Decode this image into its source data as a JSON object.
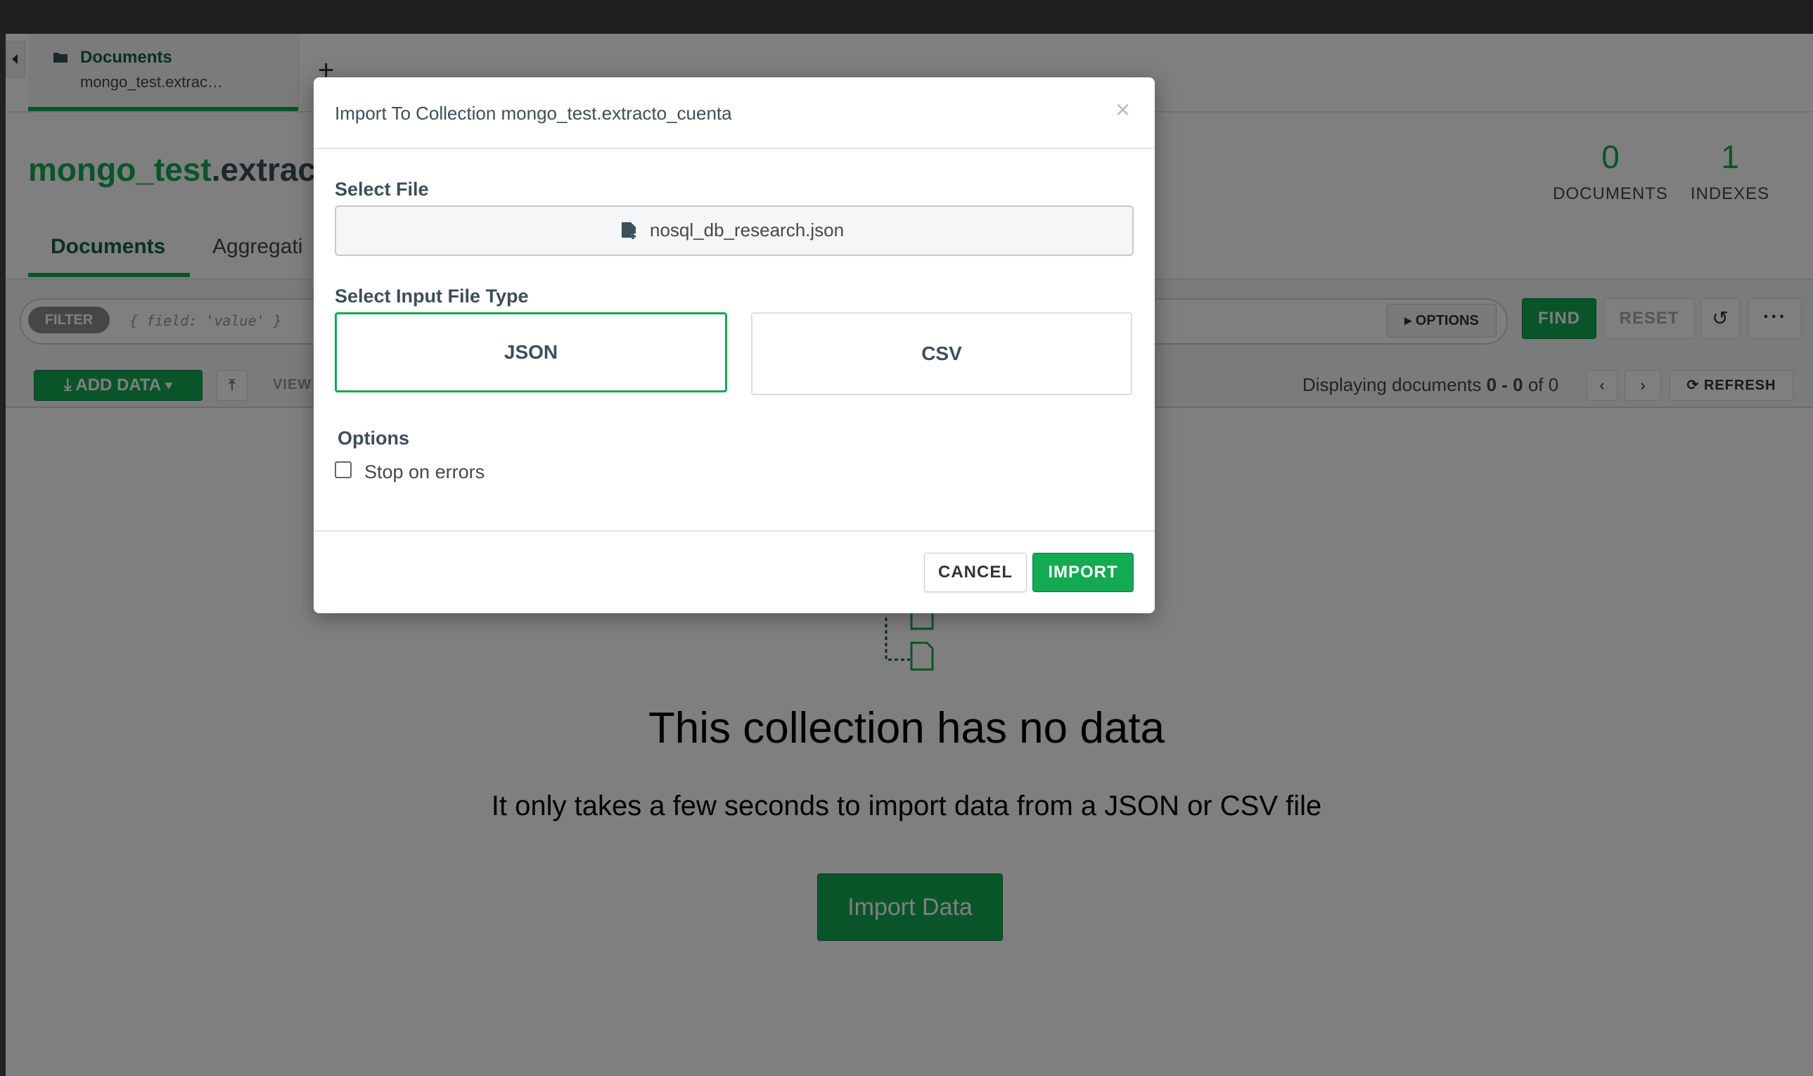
{
  "tab": {
    "title": "Documents",
    "subtitle": "mongo_test.extrac…",
    "add_label": "+"
  },
  "collection": {
    "db": "mongo_test",
    "name": ".extract"
  },
  "stats": {
    "documents_count": "0",
    "documents_label": "DOCUMENTS",
    "indexes_count": "1",
    "indexes_label": "INDEXES"
  },
  "subtabs": [
    {
      "label": "Documents",
      "active": true
    },
    {
      "label": "Aggregati"
    }
  ],
  "filter": {
    "pill_label": "FILTER",
    "placeholder": "{ field: 'value' }",
    "options_label": "OPTIONS",
    "find_label": "FIND",
    "reset_label": "RESET"
  },
  "toolbar": {
    "add_data_label": "ADD DATA",
    "view_label": "VIEW",
    "displaying_prefix": "Displaying documents ",
    "displaying_range": "0 - 0",
    "displaying_of": " of ",
    "displaying_total": "0",
    "refresh_label": "REFRESH"
  },
  "empty_state": {
    "title": "This collection has no data",
    "subtitle": "It only takes a few seconds to import data from a JSON or CSV file",
    "button_label": "Import Data"
  },
  "modal": {
    "title": "Import To Collection mongo_test.extracto_cuenta",
    "close_glyph": "×",
    "select_file_label": "Select File",
    "file_name": "nosql_db_research.json",
    "input_type_label": "Select Input File Type",
    "types": [
      {
        "label": "JSON",
        "selected": true
      },
      {
        "label": "CSV",
        "selected": false
      }
    ],
    "options_label": "Options",
    "stop_on_errors_label": "Stop on errors",
    "stop_on_errors_checked": false,
    "cancel_label": "CANCEL",
    "import_label": "IMPORT"
  },
  "colors": {
    "accent_green": "#13aa52",
    "dark_green": "#116149",
    "text": "#494747",
    "overlay": "rgba(0,0,0,0.5)"
  },
  "icons": {
    "tab": "folder-icon",
    "file": "file-add-icon",
    "add_data": "download-icon",
    "export": "upload-icon",
    "history": "history-icon",
    "more": "ellipsis-icon",
    "prev": "chevron-left-icon",
    "next": "chevron-right-icon",
    "refresh": "refresh-icon",
    "empty": "documents-icon"
  }
}
